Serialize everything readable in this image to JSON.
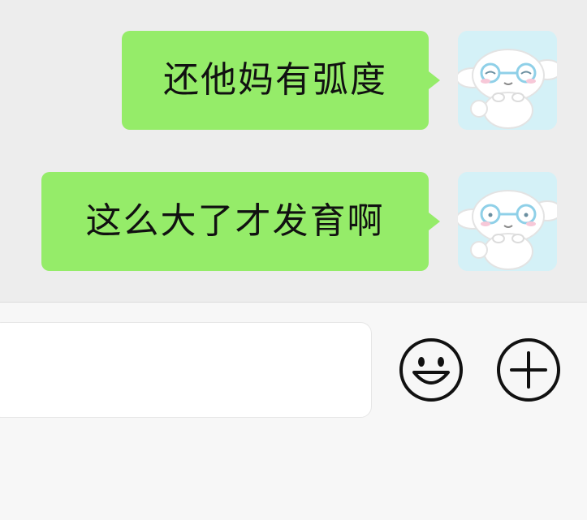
{
  "messages": [
    {
      "text": "还他妈有弧度",
      "sender": "self"
    },
    {
      "text": "这么大了才发育啊",
      "sender": "self"
    }
  ],
  "avatar": {
    "icon": "cinnamoroll-avatar",
    "background": "#d4f1f7"
  },
  "input_bar": {
    "text_field_value": "",
    "emoji_icon": "emoji-icon",
    "more_icon": "plus-circle-icon"
  },
  "colors": {
    "bubble": "#95ec69",
    "chat_background": "#ededed",
    "input_background": "#f7f7f7"
  }
}
